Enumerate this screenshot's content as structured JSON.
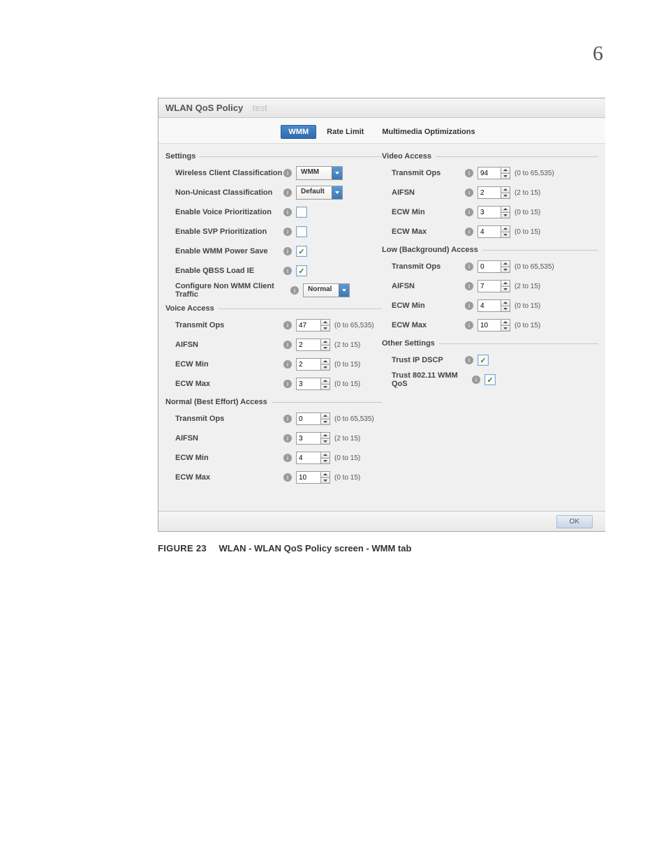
{
  "page_number": "6",
  "titlebar": {
    "prefix": "WLAN QoS Policy",
    "name": "test"
  },
  "tabs": {
    "wmm": "WMM",
    "rate": "Rate Limit",
    "mmo": "Multimedia Optimizations"
  },
  "groups": {
    "settings": "Settings",
    "voice": "Voice Access",
    "normal": "Normal (Best Effort) Access",
    "video": "Video Access",
    "low": "Low (Background) Access",
    "other": "Other Settings"
  },
  "settings": {
    "wcc": {
      "label": "Wireless Client Classification",
      "value": "WMM"
    },
    "nuc": {
      "label": "Non-Unicast Classification",
      "value": "Default"
    },
    "voice_pri": {
      "label": "Enable Voice Prioritization"
    },
    "svp_pri": {
      "label": "Enable SVP Prioritization"
    },
    "wmm_ps": {
      "label": "Enable WMM Power Save"
    },
    "qbss": {
      "label": "Enable QBSS Load IE"
    },
    "nonwmm": {
      "label": "Configure Non WMM Client Traffic",
      "value": "Normal"
    }
  },
  "ranges": {
    "ops": "(0 to 65,535)",
    "aifsn": "(2 to 15)",
    "ecw": "(0 to 15)"
  },
  "labels": {
    "transmit_ops": "Transmit Ops",
    "aifsn": "AIFSN",
    "ecw_min": "ECW Min",
    "ecw_max": "ECW Max",
    "trust_dscp": "Trust IP DSCP",
    "trust_wmm": "Trust 802.11 WMM QoS"
  },
  "voice": {
    "ops": "47",
    "aifsn": "2",
    "ecwmin": "2",
    "ecwmax": "3"
  },
  "normal": {
    "ops": "0",
    "aifsn": "3",
    "ecwmin": "4",
    "ecwmax": "10"
  },
  "video": {
    "ops": "94",
    "aifsn": "2",
    "ecwmin": "3",
    "ecwmax": "4"
  },
  "low": {
    "ops": "0",
    "aifsn": "7",
    "ecwmin": "4",
    "ecwmax": "10"
  },
  "buttons": {
    "ok": "OK"
  },
  "caption": {
    "fig": "FIGURE 23",
    "text": "WLAN - WLAN QoS Policy screen - WMM tab"
  }
}
